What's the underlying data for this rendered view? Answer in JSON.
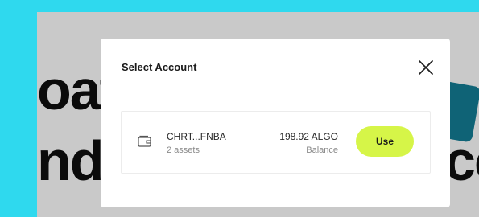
{
  "background": {
    "line1": "oat",
    "line2": "nd",
    "line3": "ce"
  },
  "modal": {
    "title": "Select Account",
    "close_icon": "close-icon"
  },
  "account": {
    "icon": "wallet-icon",
    "name": "CHRT...FNBA",
    "assets": "2 assets",
    "balance": "198.92 ALGO",
    "balance_label": "Balance",
    "use_label": "Use"
  },
  "colors": {
    "outer": "#2fd9ee",
    "backdrop": "#c9c9c9",
    "accent_button": "#d6f548",
    "card": "#0f6376"
  }
}
